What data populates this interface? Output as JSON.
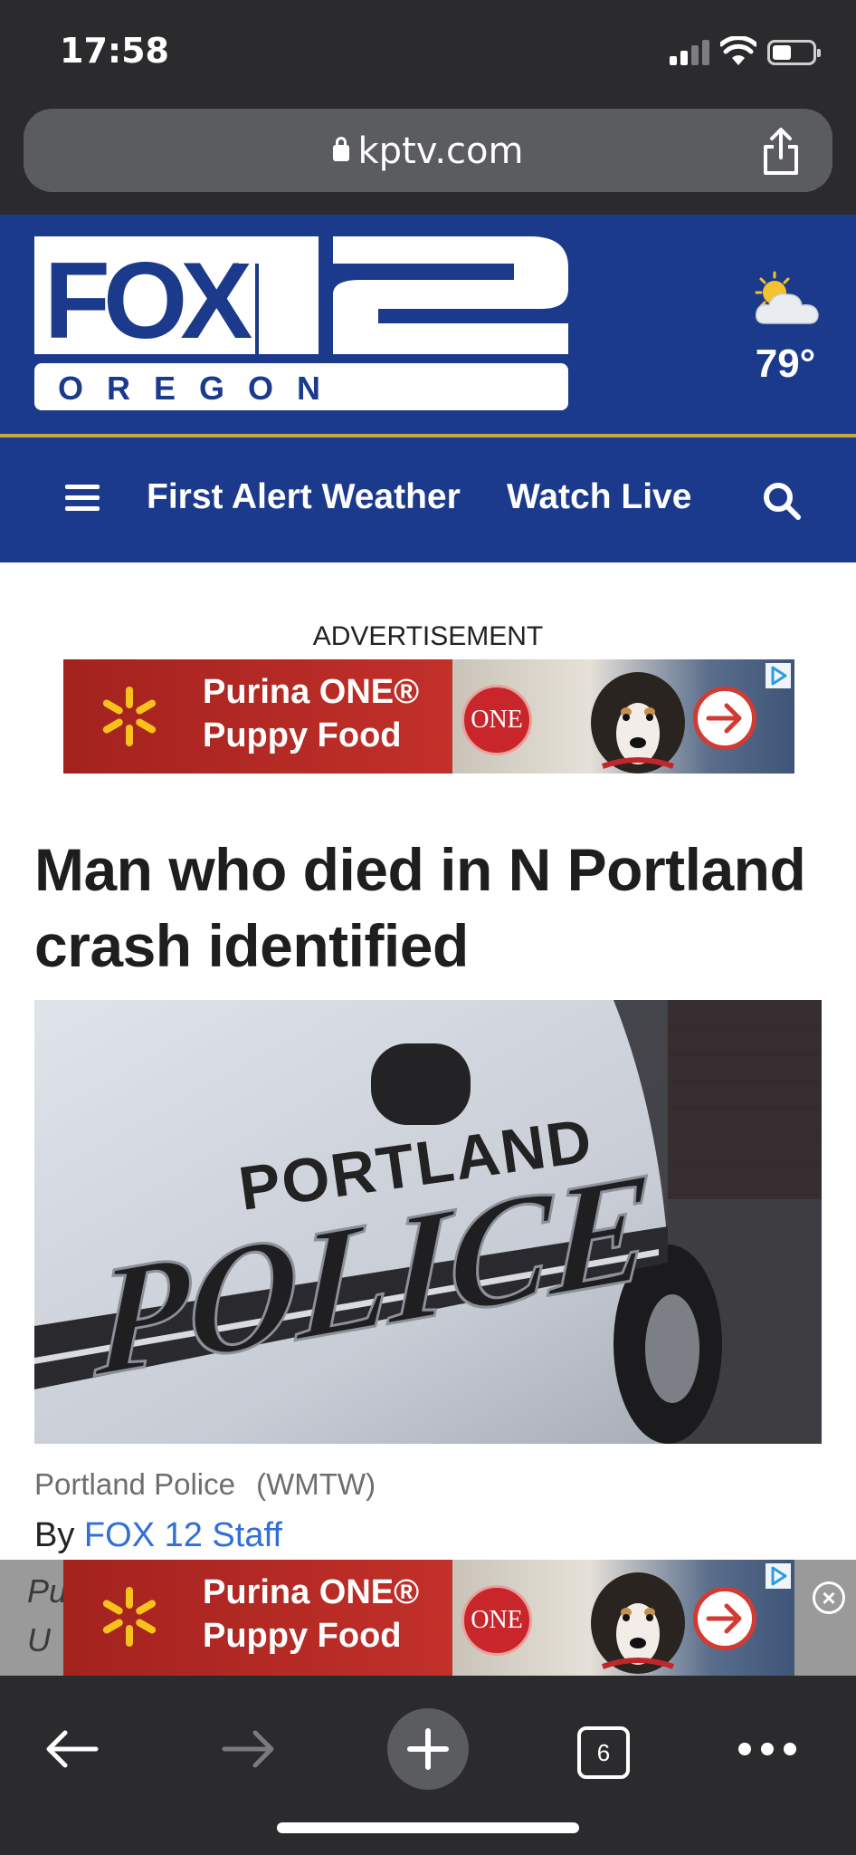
{
  "status_bar": {
    "time": "17:58"
  },
  "browser": {
    "url": "kptv.com",
    "open_tabs": "6"
  },
  "site": {
    "logo_brand": "FOX",
    "logo_number": "12",
    "logo_region": "OREGON",
    "temperature": "79°",
    "weather_icon": "partly-cloudy-icon",
    "brand_color": "#1b3a8c",
    "accent_color": "#c9a64a"
  },
  "nav": {
    "links": [
      "First Alert Weather",
      "Watch Live"
    ]
  },
  "advertisement": {
    "label": "ADVERTISEMENT",
    "line1": "Purina ONE®",
    "line2": "Puppy Food",
    "badge": "ONE"
  },
  "article": {
    "headline": "Man who died in N Portland crash identified",
    "image_text_top": "PORTLAND",
    "image_text_main": "POLICE",
    "caption": "Portland Police",
    "caption_credit": "(WMTW)",
    "byline_prefix": "By",
    "author": "FOX 12 Staff"
  },
  "sticky_ad": {
    "line1": "Purina ONE®",
    "line2": "Puppy Food",
    "badge": "ONE",
    "bleed_line1": "Pu",
    "bleed_line2": "U"
  }
}
